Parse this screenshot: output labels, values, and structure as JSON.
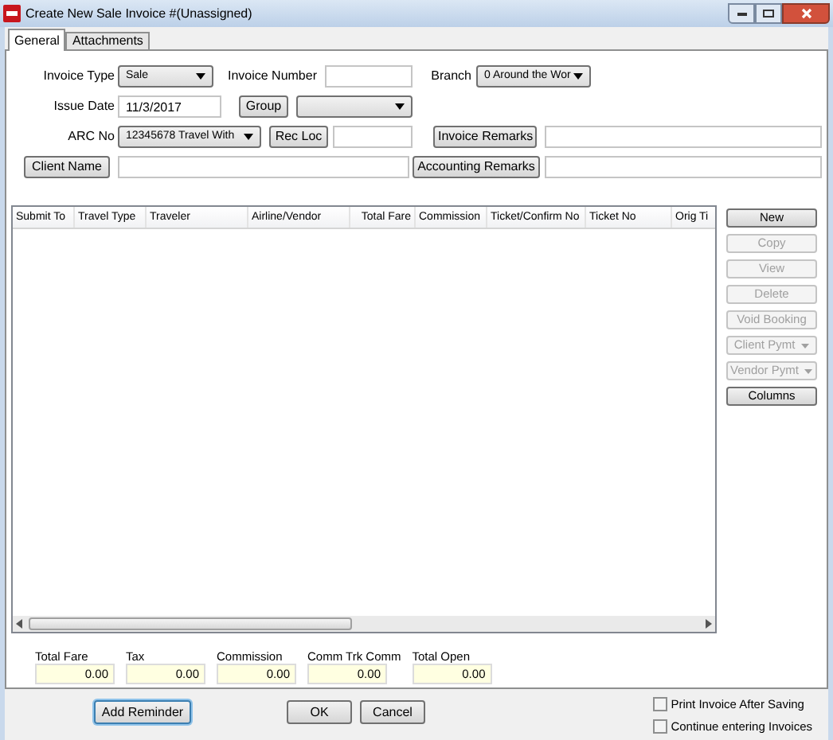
{
  "window": {
    "title": "Create New Sale Invoice #(Unassigned)"
  },
  "tabs": [
    {
      "label": "General",
      "selected": true
    },
    {
      "label": "Attachments",
      "selected": false
    }
  ],
  "form": {
    "invoice_type": {
      "label": "Invoice Type",
      "value": "Sale"
    },
    "invoice_number": {
      "label": "Invoice Number"
    },
    "branch": {
      "label": "Branch",
      "value": "0 Around the Wor"
    },
    "issue_date": {
      "label": "Issue Date",
      "value": "11/3/2017"
    },
    "group": {
      "button": "Group"
    },
    "arc_no": {
      "label": "ARC No",
      "value": "12345678 Travel With"
    },
    "rec_loc": {
      "button": "Rec Loc"
    },
    "invoice_remarks": {
      "button": "Invoice Remarks"
    },
    "client_name": {
      "button": "Client Name"
    },
    "accounting_remarks": {
      "button": "Accounting Remarks"
    }
  },
  "table": {
    "columns": [
      "Submit To",
      "Travel Type",
      "Traveler",
      "Airline/Vendor",
      "Total Fare",
      "Commission",
      "Ticket/Confirm No",
      "Ticket No",
      "Orig Ti"
    ]
  },
  "side_buttons": [
    {
      "label": "New",
      "disabled": false,
      "kind": "button"
    },
    {
      "label": "Copy",
      "disabled": true,
      "kind": "button"
    },
    {
      "label": "View",
      "disabled": true,
      "kind": "button"
    },
    {
      "label": "Delete",
      "disabled": true,
      "kind": "button"
    },
    {
      "label": "Void Booking",
      "disabled": true,
      "kind": "button"
    },
    {
      "label": "Client Pymt",
      "disabled": true,
      "kind": "dropdown"
    },
    {
      "label": "Vendor Pymt",
      "disabled": true,
      "kind": "dropdown"
    },
    {
      "label": "Columns",
      "disabled": false,
      "kind": "button"
    }
  ],
  "totals": [
    {
      "label": "Total Fare",
      "value": "0.00"
    },
    {
      "label": "Tax",
      "value": "0.00"
    },
    {
      "label": "Commission",
      "value": "0.00"
    },
    {
      "label": "Comm Trk Comm",
      "value": "0.00"
    },
    {
      "label": "Total Open",
      "value": "0.00"
    }
  ],
  "footer": {
    "buttons": [
      {
        "label": "Add Reminder",
        "focused": true
      },
      {
        "label": "OK",
        "focused": false
      },
      {
        "label": "Cancel",
        "focused": false
      }
    ],
    "checkboxes": [
      {
        "label": "Print Invoice After Saving",
        "checked": false
      },
      {
        "label": "Continue entering Invoices",
        "checked": false
      }
    ]
  }
}
